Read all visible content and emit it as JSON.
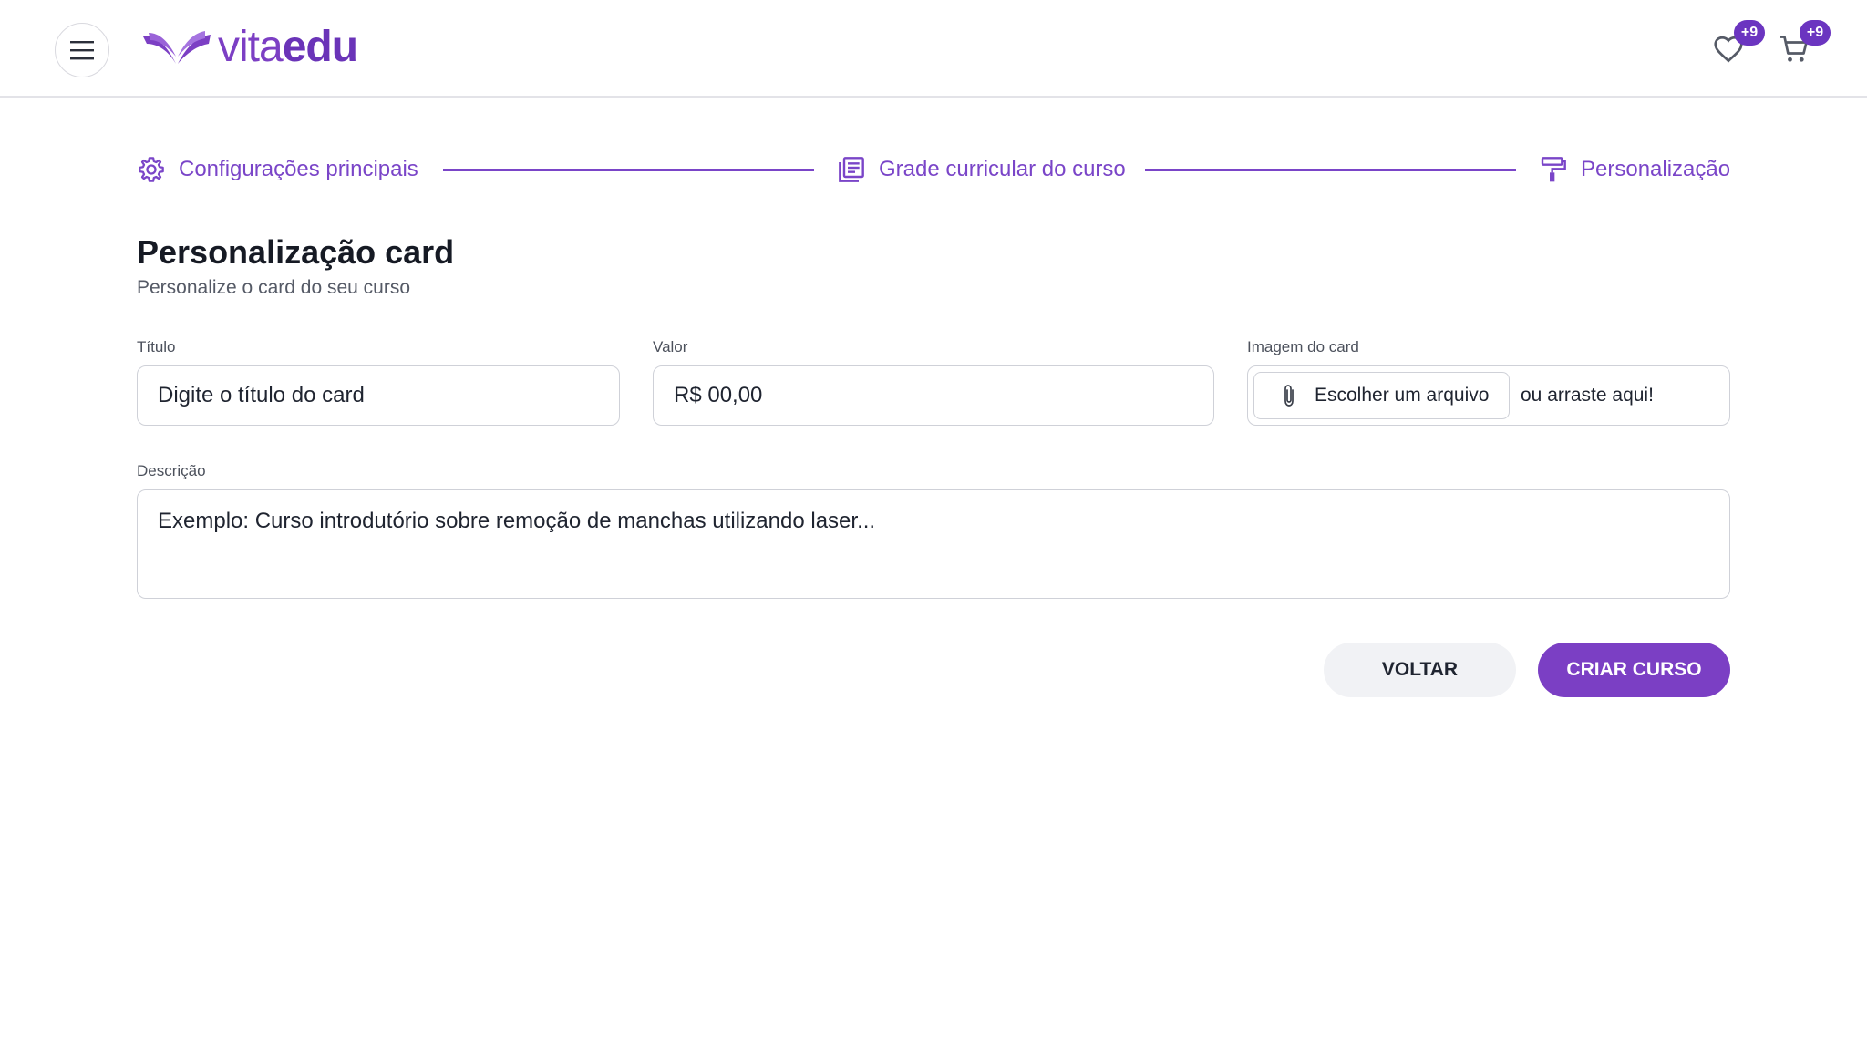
{
  "header": {
    "logo_text_vita": "vita",
    "logo_text_edu": "edu",
    "favorites_badge": "+9",
    "cart_badge": "+9"
  },
  "stepper": {
    "steps": [
      {
        "label": "Configurações principais",
        "icon": "gear-icon"
      },
      {
        "label": "Grade curricular do curso",
        "icon": "document-list-icon"
      },
      {
        "label": "Personalização",
        "icon": "paint-roller-icon"
      }
    ],
    "accent_color": "#7a45c8"
  },
  "section": {
    "title": "Personalização card",
    "subtitle": "Personalize o card do seu curso"
  },
  "form": {
    "title_label": "Título",
    "title_placeholder": "Digite o título do card",
    "value_label": "Valor",
    "value_placeholder": "R$ 00,00",
    "image_label": "Imagem do card",
    "file_button": "Escolher um arquivo",
    "file_hint": "ou arraste aqui!",
    "description_label": "Descrição",
    "description_placeholder": "Exemplo: Curso introdutório sobre remoção de manchas utilizando laser..."
  },
  "actions": {
    "back": "VOLTAR",
    "create": "CRIAR CURSO"
  },
  "colors": {
    "brand": "#7b3fc4",
    "badge": "#6b35c0"
  }
}
